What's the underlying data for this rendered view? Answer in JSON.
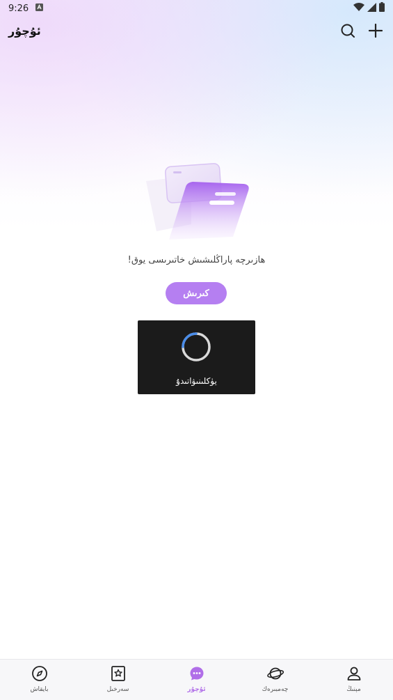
{
  "status_bar": {
    "time": "9:26"
  },
  "header": {
    "title": "ئۇچۇر"
  },
  "empty_state": {
    "message": "ھازىرچە پاراڭلىشىش خاتىرىسى يوق!",
    "login_label": "كىرىش"
  },
  "loading": {
    "text": "يۈكلىنىۋاتىدۇ"
  },
  "bottom_nav": {
    "items": [
      {
        "label": "بايقاش",
        "icon": "compass-icon"
      },
      {
        "label": "سەرخىل",
        "icon": "star-bookmark-icon"
      },
      {
        "label": "ئۇچۇر",
        "icon": "message-icon"
      },
      {
        "label": "چەمبىرەك",
        "icon": "planet-icon"
      },
      {
        "label": "مېنىڭ",
        "icon": "user-icon"
      }
    ],
    "active_index": 2
  },
  "colors": {
    "accent": "#b57ff1",
    "toast_bg": "#1b1b1b"
  }
}
